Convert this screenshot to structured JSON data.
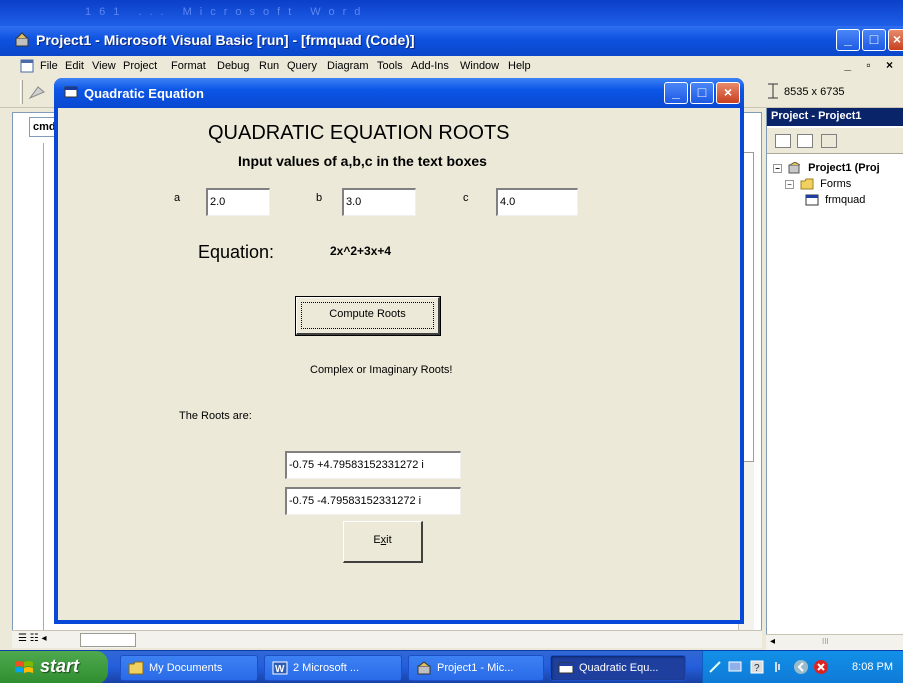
{
  "background_title_fragment": "161 ... Microsoft Word",
  "ide": {
    "title": "Project1 - Microsoft Visual Basic [run] - [frmquad (Code)]",
    "window_controls": [
      "_",
      "□",
      "×"
    ],
    "menu": [
      "File",
      "Edit",
      "View",
      "Project",
      "Format",
      "Debug",
      "Run",
      "Query",
      "Diagram",
      "Tools",
      "Add-Ins",
      "Window",
      "Help"
    ],
    "mdi_controls": "_ ▫ ×",
    "size_readout": "8535 x 6735",
    "code_combo": "cmd"
  },
  "project_explorer": {
    "title": "Project - Project1",
    "tree": [
      {
        "label": "Project1 (Proj",
        "level": 0,
        "expander": "−"
      },
      {
        "label": "Forms",
        "level": 1,
        "expander": "−"
      },
      {
        "label": "frmquad",
        "level": 2,
        "expander": ""
      }
    ],
    "scroll_mark": "III"
  },
  "form": {
    "title": "Quadratic Equation",
    "heading": "QUADRATIC EQUATION ROOTS",
    "subheading": "Input values of a,b,c in the text boxes",
    "labels": {
      "a": "a",
      "b": "b",
      "c": "c"
    },
    "inputs": {
      "a": "2.0",
      "b": "3.0",
      "c": "4.0"
    },
    "equation_label": "Equation:",
    "equation_value": "2x^2+3x+4",
    "compute_button": "Compute Roots",
    "status": "Complex or Imaginary Roots!",
    "roots_label": "The Roots are:",
    "root1": "-0.75 +4.79583152331272 i",
    "root2": "-0.75 -4.79583152331272 i",
    "exit_button": "Exit",
    "exit_mnemonic": "x"
  },
  "taskbar": {
    "start": "start",
    "tasks": [
      {
        "label": "My Documents",
        "icon": "folder-icon",
        "active": false
      },
      {
        "label": "2 Microsoft ...",
        "icon": "word-icon",
        "active": false
      },
      {
        "label": "Project1 - Mic...",
        "icon": "vb-icon",
        "active": false
      },
      {
        "label": "Quadratic Equ...",
        "icon": "form-icon",
        "active": true
      }
    ],
    "clock": "8:08 PM"
  },
  "colors": {
    "xp_blue": "#0a48d0",
    "form_face": "#ece9d8",
    "start_green": "#3c9a3c",
    "tray_blue": "#0f7ad6"
  }
}
